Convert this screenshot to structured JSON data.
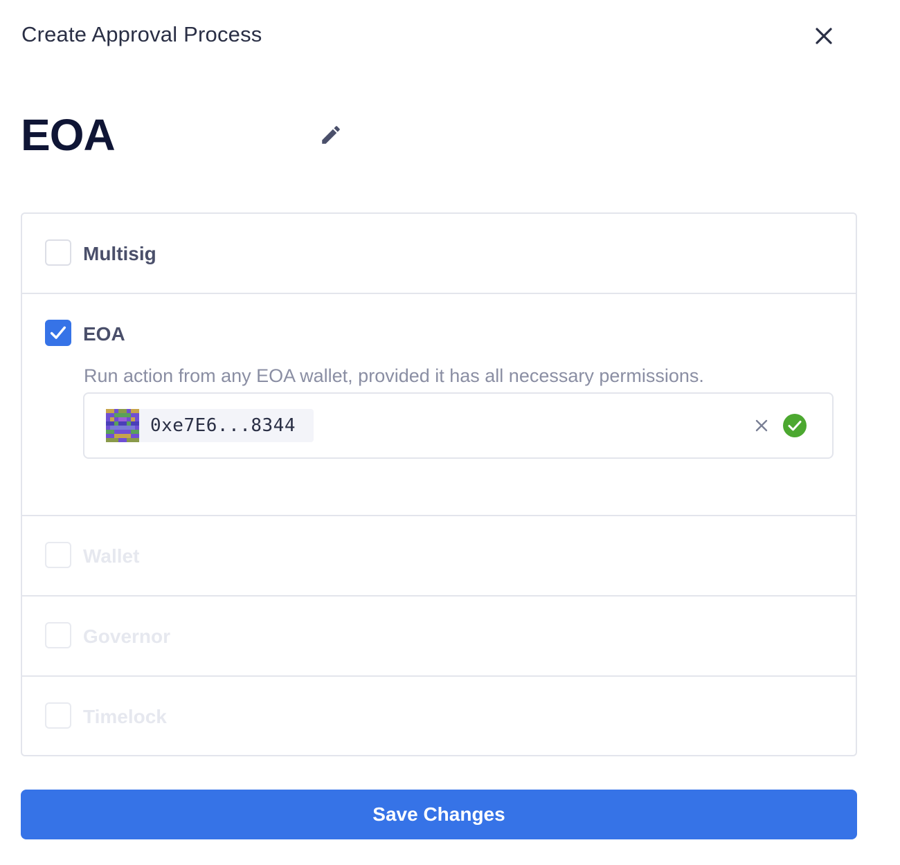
{
  "dialog": {
    "title": "Create Approval Process",
    "close_icon": "close-icon"
  },
  "process": {
    "name": "EOA",
    "edit_icon": "pencil-icon"
  },
  "options": [
    {
      "label": "Multisig",
      "checked": false,
      "disabled": false
    },
    {
      "label": "EOA",
      "checked": true,
      "disabled": false,
      "description": "Run action from any EOA wallet, provided it has all necessary permissions.",
      "address": {
        "value": "0xe7E6...8344",
        "avatar_icon": "identicon-avatar",
        "remove_icon": "close-icon",
        "status_icon": "check-circle-icon",
        "status_color": "#4ca830"
      }
    },
    {
      "label": "Wallet",
      "checked": false,
      "disabled": true
    },
    {
      "label": "Governor",
      "checked": false,
      "disabled": true
    },
    {
      "label": "Timelock",
      "checked": false,
      "disabled": true
    }
  ],
  "actions": {
    "save_label": "Save Changes"
  },
  "colors": {
    "accent": "#3673e7",
    "success": "#4ca830",
    "border": "#e3e5ec"
  }
}
